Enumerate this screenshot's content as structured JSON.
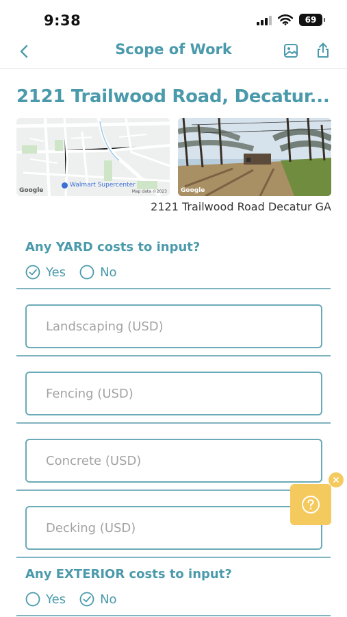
{
  "status_bar": {
    "time": "9:38",
    "battery": "69"
  },
  "nav": {
    "title": "Scope of Work"
  },
  "property": {
    "title": "2121 Trailwood Road, Decatur...",
    "caption": "2121 Trailwood Road Decatur GA",
    "map_poi": "Walmart Supercenter",
    "map_google": "Google",
    "map_attribution": "Map data ©2023",
    "street_google": "Google"
  },
  "yard": {
    "question": "Any YARD costs to input?",
    "yes_label": "Yes",
    "no_label": "No",
    "selected": "Yes",
    "fields": [
      {
        "placeholder": "Landscaping (USD)",
        "value": ""
      },
      {
        "placeholder": "Fencing (USD)",
        "value": ""
      },
      {
        "placeholder": "Concrete (USD)",
        "value": ""
      },
      {
        "placeholder": "Decking (USD)",
        "value": ""
      }
    ]
  },
  "exterior": {
    "question": "Any EXTERIOR costs to input?",
    "yes_label": "Yes",
    "no_label": "No",
    "selected": "No"
  },
  "colors": {
    "accent": "#4a9aab",
    "field_border": "#6aaab8",
    "help_yellow": "#f4c95d"
  },
  "icons": {
    "back": "chevron-left-icon",
    "gallery": "image-icon",
    "share": "share-icon",
    "help": "question-circle-icon",
    "help_close": "close-icon",
    "checked": "check-circle-icon",
    "unchecked": "empty-circle-icon"
  }
}
